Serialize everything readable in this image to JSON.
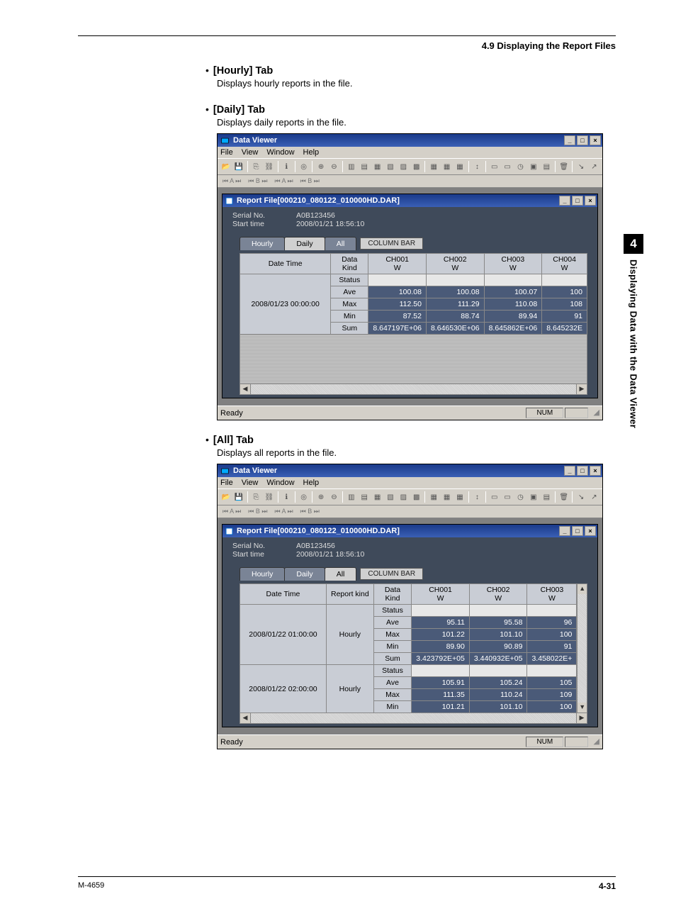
{
  "header": {
    "section": "4.9  Displaying the Report Files"
  },
  "bullets": {
    "hourly": {
      "title": "[Hourly] Tab",
      "desc": "Displays hourly reports in the file."
    },
    "daily": {
      "title": "[Daily] Tab",
      "desc": "Displays daily reports in the file."
    },
    "all": {
      "title": "[All] Tab",
      "desc": "Displays all reports in the file."
    }
  },
  "window": {
    "title": "Data Viewer",
    "menus": [
      "File",
      "View",
      "Window",
      "Help"
    ],
    "inner_title": "Report File[000210_080122_010000HD.DAR]",
    "info": {
      "serial_label": "Serial No.",
      "serial_value": "A0B123456",
      "start_label": "Start time",
      "start_value": "2008/01/21 18:56:10"
    },
    "tabs": [
      "Hourly",
      "Daily",
      "All"
    ],
    "col_bar": "COLUMN BAR",
    "ready": "Ready",
    "num": "NUM"
  },
  "daily_table": {
    "headers": {
      "datetime": "Date Time",
      "datakind": "Data Kind",
      "ch": [
        "CH001",
        "CH002",
        "CH003",
        "CH004"
      ],
      "sub": "W"
    },
    "datetime": "2008/01/23 00:00:00",
    "rows": [
      {
        "kind": "Status",
        "v": [
          "",
          "",
          "",
          ""
        ]
      },
      {
        "kind": "Ave",
        "v": [
          "100.08",
          "100.08",
          "100.07",
          "100"
        ]
      },
      {
        "kind": "Max",
        "v": [
          "112.50",
          "111.29",
          "110.08",
          "108"
        ]
      },
      {
        "kind": "Min",
        "v": [
          "87.52",
          "88.74",
          "89.94",
          "91"
        ]
      },
      {
        "kind": "Sum",
        "v": [
          "8.647197E+06",
          "8.646530E+06",
          "8.645862E+06",
          "8.645232E"
        ]
      }
    ]
  },
  "all_table": {
    "headers": {
      "datetime": "Date Time",
      "reportkind": "Report kind",
      "datakind": "Data Kind",
      "ch": [
        "CH001",
        "CH002",
        "CH003"
      ],
      "sub": "W"
    },
    "groups": [
      {
        "datetime": "2008/01/22 01:00:00",
        "report": "Hourly",
        "rows": [
          {
            "kind": "Status",
            "v": [
              "",
              "",
              ""
            ]
          },
          {
            "kind": "Ave",
            "v": [
              "95.11",
              "95.58",
              "96"
            ]
          },
          {
            "kind": "Max",
            "v": [
              "101.22",
              "101.10",
              "100"
            ]
          },
          {
            "kind": "Min",
            "v": [
              "89.90",
              "90.89",
              "91"
            ]
          },
          {
            "kind": "Sum",
            "v": [
              "3.423792E+05",
              "3.440932E+05",
              "3.458022E+"
            ]
          }
        ]
      },
      {
        "datetime": "2008/01/22 02:00:00",
        "report": "Hourly",
        "rows": [
          {
            "kind": "Status",
            "v": [
              "",
              "",
              ""
            ]
          },
          {
            "kind": "Ave",
            "v": [
              "105.91",
              "105.24",
              "105"
            ]
          },
          {
            "kind": "Max",
            "v": [
              "111.35",
              "110.24",
              "109"
            ]
          },
          {
            "kind": "Min",
            "v": [
              "101.21",
              "101.10",
              "100"
            ]
          }
        ]
      }
    ]
  },
  "side": {
    "num": "4",
    "text": "Displaying Data with the Data Viewer"
  },
  "footer": {
    "left": "M-4659",
    "right": "4-31"
  }
}
